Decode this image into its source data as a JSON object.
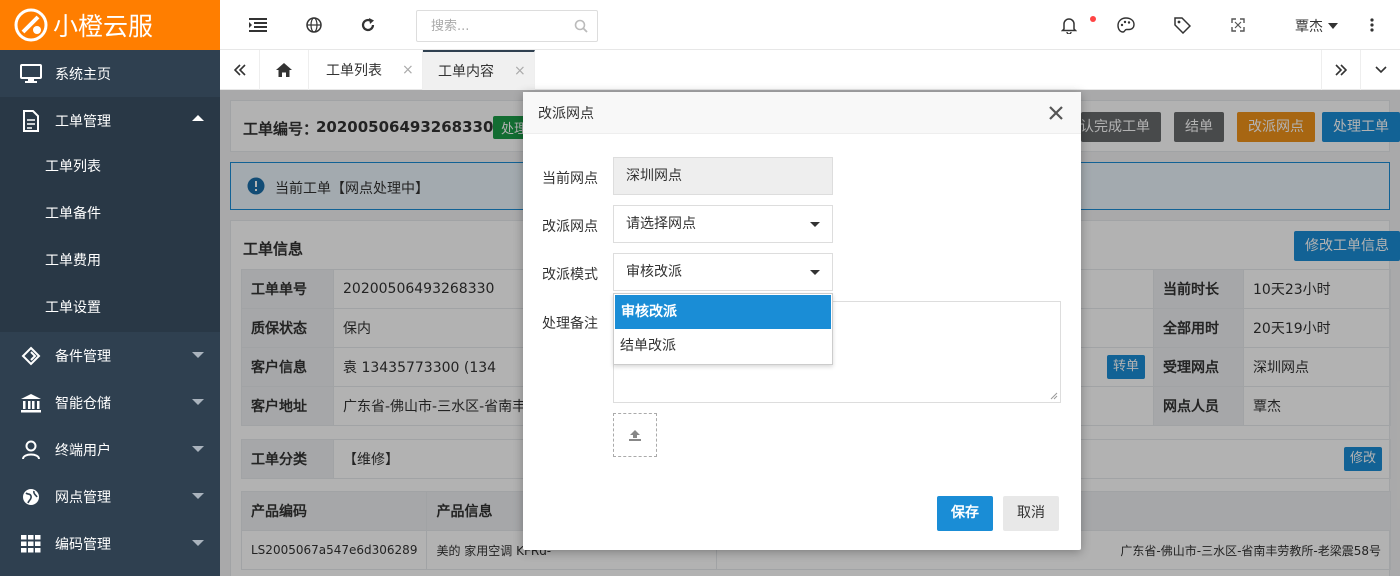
{
  "brand": {
    "name": "小橙云服"
  },
  "sidebar": {
    "items": [
      {
        "label": "系统主页",
        "icon": "monitor-icon"
      },
      {
        "label": "工单管理",
        "icon": "document-icon"
      },
      {
        "label": "备件管理",
        "icon": "diamond-icon"
      },
      {
        "label": "智能仓储",
        "icon": "bank-icon"
      },
      {
        "label": "终端用户",
        "icon": "user-icon"
      },
      {
        "label": "网点管理",
        "icon": "globe-icon"
      },
      {
        "label": "编码管理",
        "icon": "grid-icon"
      }
    ],
    "subitems": [
      "工单列表",
      "工单备件",
      "工单费用",
      "工单设置"
    ]
  },
  "topbar": {
    "search_placeholder": "搜索...",
    "user_name": "覃杰"
  },
  "tabs": [
    {
      "label": "工单列表",
      "active": false
    },
    {
      "label": "工单内容",
      "active": true
    }
  ],
  "order": {
    "number_label": "工单编号：",
    "number": "20200506493268330",
    "status_badge": "处理",
    "notice": "当前工单【网点处理中】",
    "actions": [
      "确认完成工单",
      "结单",
      "改派网点",
      "处理工单"
    ],
    "info_title": "工单信息",
    "edit_info_button": "修改工单信息",
    "info_rows": [
      {
        "label": "工单单号",
        "value": "20200506493268330",
        "label2": "当前时长",
        "value2": "10天23小时"
      },
      {
        "label": "质保状态",
        "value": "保内",
        "label2": "全部用时",
        "value2": "20天19小时"
      },
      {
        "label": "客户信息",
        "value": "袁 13435773300 (134",
        "label2": "受理网点",
        "value2": "深圳网点"
      },
      {
        "label": "客户地址",
        "value": "广东省-佛山市-三水区-省南丰",
        "label2": "网点人员",
        "value2": "覃杰"
      }
    ],
    "transfer_button": "转单",
    "category_label": "工单分类",
    "category_value": "【维修】",
    "category_edit_button": "修改",
    "product_headers": [
      "产品编码",
      "产品信息"
    ],
    "product_row": {
      "code": "LS2005067a547e6d306289",
      "info": "美的 家用空调 KFRd-",
      "address": "广东省-佛山市-三水区-省南丰劳教所-老梁震58号"
    }
  },
  "modal": {
    "title": "改派网点",
    "fields": {
      "current_label": "当前网点",
      "current_value": "深圳网点",
      "assign_label": "改派网点",
      "assign_value": "请选择网点",
      "mode_label": "改派模式",
      "mode_value": "审核改派",
      "remark_label": "处理备注"
    },
    "mode_options": [
      "审核改派",
      "结单改派"
    ],
    "save_button": "保存",
    "cancel_button": "取消"
  },
  "colors": {
    "brand": "#ff7e00",
    "sidebar": "#2f4050",
    "primary": "#1a8dd6",
    "warning": "#f0921a",
    "dark_button": "#676a6c",
    "success": "#1ab394"
  }
}
